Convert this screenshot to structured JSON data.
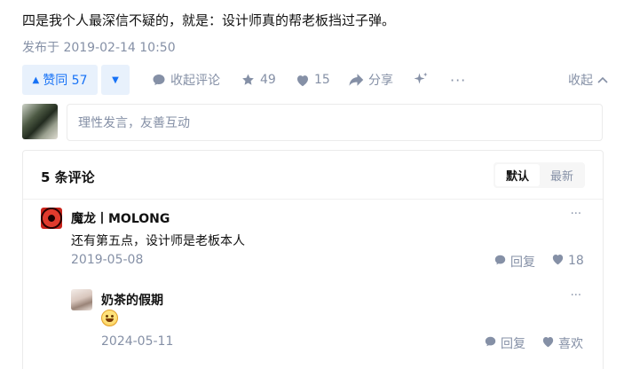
{
  "answer": {
    "text": "四是我个人最深信不疑的，就是：设计师真的帮老板挡过子弹。",
    "published": "发布于 2019-02-14 10:50"
  },
  "actions": {
    "upvote_label": "赞同 57",
    "comment_label": "收起评论",
    "star_count": "49",
    "like_count": "15",
    "share_label": "分享",
    "more_label": "···",
    "collapse_label": "收起"
  },
  "composer": {
    "placeholder": "理性发言，友善互动"
  },
  "comments": {
    "count_label": "5 条评论",
    "sort_default": "默认",
    "sort_new": "最新",
    "items": [
      {
        "author": "魔龙丨MOLONG",
        "content": "还有第五点，设计师是老板本人",
        "date": "2019-05-08",
        "reply_label": "回复",
        "like_value": "18"
      },
      {
        "author": "奶茶的假期",
        "content": "",
        "date": "2024-05-11",
        "reply_label": "回复",
        "like_value": "喜欢"
      }
    ],
    "more_label": "···"
  },
  "colors": {
    "accent": "#1772f6",
    "muted": "#8590a6",
    "vote_bg": "#e8f1fc"
  }
}
